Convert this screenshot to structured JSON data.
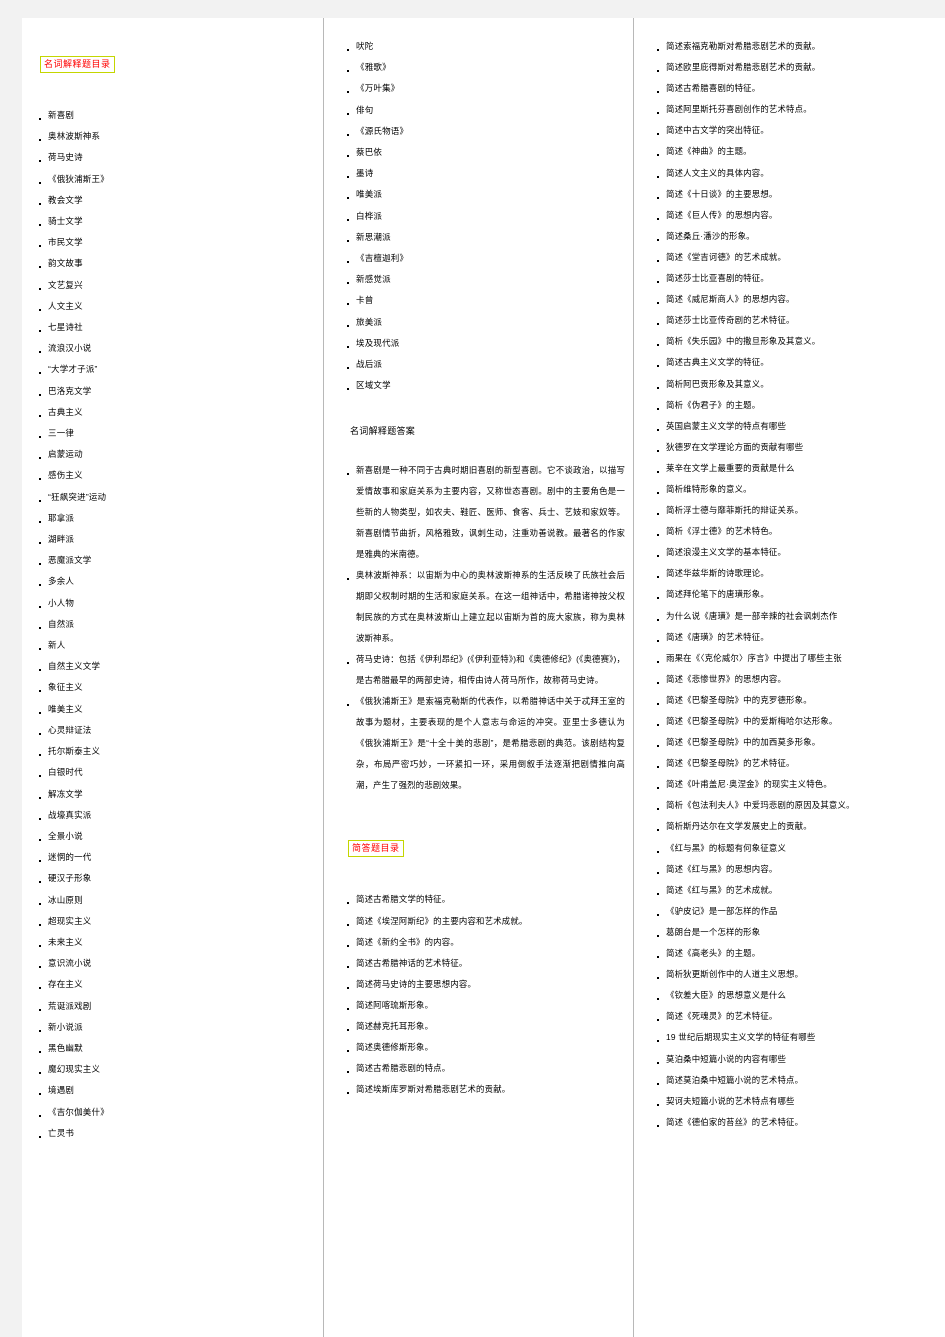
{
  "page": {
    "background": "#ffffff",
    "strip_color": "#f2f2f2",
    "heading_text_color": "#ff0000",
    "heading_border_color": "#c4d600"
  },
  "column_one": {
    "heading": "名词解释题目录",
    "items": [
      "新喜剧",
      "奥林波斯神系",
      "荷马史诗",
      "《俄狄浦斯王》",
      "教会文学",
      "骑士文学",
      "市民文学",
      "韵文故事",
      "文艺复兴",
      "人文主义",
      "七星诗社",
      "流浪汉小说",
      "“大学才子派”",
      "巴洛克文学",
      "古典主义",
      "三一律",
      "启蒙运动",
      "感伤主义",
      "“狂飙突进”运动",
      "耶拿派",
      "湖畔派",
      "恶魔派文学",
      "多余人",
      "小人物",
      "自然派",
      "新人",
      "自然主义文学",
      "象征主义",
      "唯美主义",
      "心灵辩证法",
      "托尔斯泰主义",
      "白银时代",
      "解冻文学",
      "战壕真实派",
      "全景小说",
      "迷惘的一代",
      "硬汉子形象",
      "冰山原则",
      "超现实主义",
      "未来主义",
      "意识流小说",
      "存在主义",
      "荒诞派戏剧",
      "新小说派",
      "黑色幽默",
      "魔幻现实主义",
      "境遇剧",
      "《吉尔伽美什》",
      "亡灵书"
    ]
  },
  "column_two": {
    "terms_continued": [
      "吠陀",
      "《雅歌》",
      "《万叶集》",
      "俳句",
      "《源氏物语》",
      "蔡巴依",
      "墨诗",
      "唯美派",
      "白桦派",
      "新思潮派",
      "《吉檀迦利》",
      "新感觉派",
      "卡曾",
      "旅美派",
      "埃及现代派",
      "战后派",
      "区域文学"
    ],
    "answers_heading": "名词解释题答案",
    "answers": [
      "新喜剧是一种不同于古典时期旧喜剧的新型喜剧。它不谈政治，以描写爱情故事和家庭关系为主要内容，又称世态喜剧。剧中的主要角色是一些新的人物类型，如农夫、鞋匠、医师、食客、兵士、艺妓和家奴等。新喜剧情节曲折，风格雅致，讽刺生动，注重劝善说教。最著名的作家是雅典的米南德。",
      "奥林波斯神系：以宙斯为中心的奥林波斯神系的生活反映了氏族社会后期即父权制时期的生活和家庭关系。在这一组神话中，希腊诸神按父权制民族的方式在奥林波斯山上建立起以宙斯为首的庞大家族，称为奥林波斯神系。",
      "荷马史诗：包括《伊利昂纪》(《伊利亚特》)和《奥德修纪》(《奥德赛》)，是古希腊最早的两部史诗，相传由诗人荷马所作，故称荷马史诗。",
      "《俄狄浦斯王》是索福克勒斯的代表作，以希腊神话中关于忒拜王室的故事为题材，主要表现的是个人意志与命运的冲突。亚里士多德认为《俄狄浦斯王》是“十全十美的悲剧”，是希腊悲剧的典范。该剧结构复杂，布局严密巧妙，一环紧扣一环，采用倒叙手法逐渐把剧情推向高潮，产生了强烈的悲剧效果。"
    ],
    "short_answer_heading": "简答题目录",
    "short_answer_items": [
      "简述古希腊文学的特征。",
      "简述《埃涅阿斯纪》的主要内容和艺术成就。",
      "简述《新约全书》的内容。",
      "简述古希腊神话的艺术特征。",
      "简述荷马史诗的主要思想内容。",
      "简述阿喀琉斯形象。",
      "简述赫克托耳形象。",
      "简述奥德修斯形象。",
      "简述古希腊悲剧的特点。",
      "简述埃斯库罗斯对希腊悲剧艺术的贡献。"
    ]
  },
  "column_three": {
    "items": [
      "简述索福克勒斯对希腊悲剧艺术的贡献。",
      "简述欧里庇得斯对希腊悲剧艺术的贡献。",
      "简述古希腊喜剧的特征。",
      "简述阿里斯托芬喜剧创作的艺术特点。",
      "简述中古文学的突出特征。",
      "简述《神曲》的主题。",
      "简述人文主义的具体内容。",
      "简述《十日谈》的主要思想。",
      "简述《巨人传》的思想内容。",
      "简述桑丘·潘沙的形象。",
      "简述《堂吉诃德》的艺术成就。",
      "简述莎士比亚喜剧的特征。",
      "简述《威尼斯商人》的思想内容。",
      "简述莎士比亚传奇剧的艺术特征。",
      "简析《失乐园》中的撒旦形象及其意义。",
      "简述古典主义文学的特征。",
      "简析阿巴贡形象及其意义。",
      "简析《伪君子》的主题。",
      "英国启蒙主义文学的特点有哪些",
      "狄德罗在文学理论方面的贡献有哪些",
      "莱辛在文学上最重要的贡献是什么",
      "简析维特形象的意义。",
      "简析浮士德与靡菲斯托的辩证关系。",
      "简析《浮士德》的艺术特色。",
      "简述浪漫主义文学的基本特征。",
      "简述华兹华斯的诗歌理论。",
      "简述拜伦笔下的唐璜形象。",
      "为什么说《唐璜》是一部辛辣的社会讽刺杰作",
      "简述《唐璜》的艺术特征。",
      "雨果在《〈克伦威尔〉序言》中提出了哪些主张",
      "简述《悲惨世界》的思想内容。",
      "简述《巴黎圣母院》中的克罗德形象。",
      "简述《巴黎圣母院》中的爱斯梅哈尔达形象。",
      "简述《巴黎圣母院》中的加西莫多形象。",
      "简述《巴黎圣母院》的艺术特征。",
      "简述《叶甫盖尼·奥涅金》的现实主义特色。",
      "简析《包法利夫人》中爱玛悲剧的原因及其意义。",
      "简析斯丹达尔在文学发展史上的贡献。",
      "《红与黑》的标题有何象征意义",
      "简述《红与黑》的思想内容。",
      "简述《红与黑》的艺术成就。",
      "《驴皮记》是一部怎样的作品",
      "葛朗台是一个怎样的形象",
      "简述《高老头》的主题。",
      "简析狄更斯创作中的人道主义思想。",
      "《钦差大臣》的思想意义是什么",
      "简述《死魂灵》的艺术特征。",
      "19 世纪后期现实主义文学的特征有哪些",
      "莫泊桑中短篇小说的内容有哪些",
      "简述莫泊桑中短篇小说的艺术特点。",
      "契诃夫短篇小说的艺术特点有哪些",
      "简述《德伯家的苔丝》的艺术特征。"
    ]
  }
}
